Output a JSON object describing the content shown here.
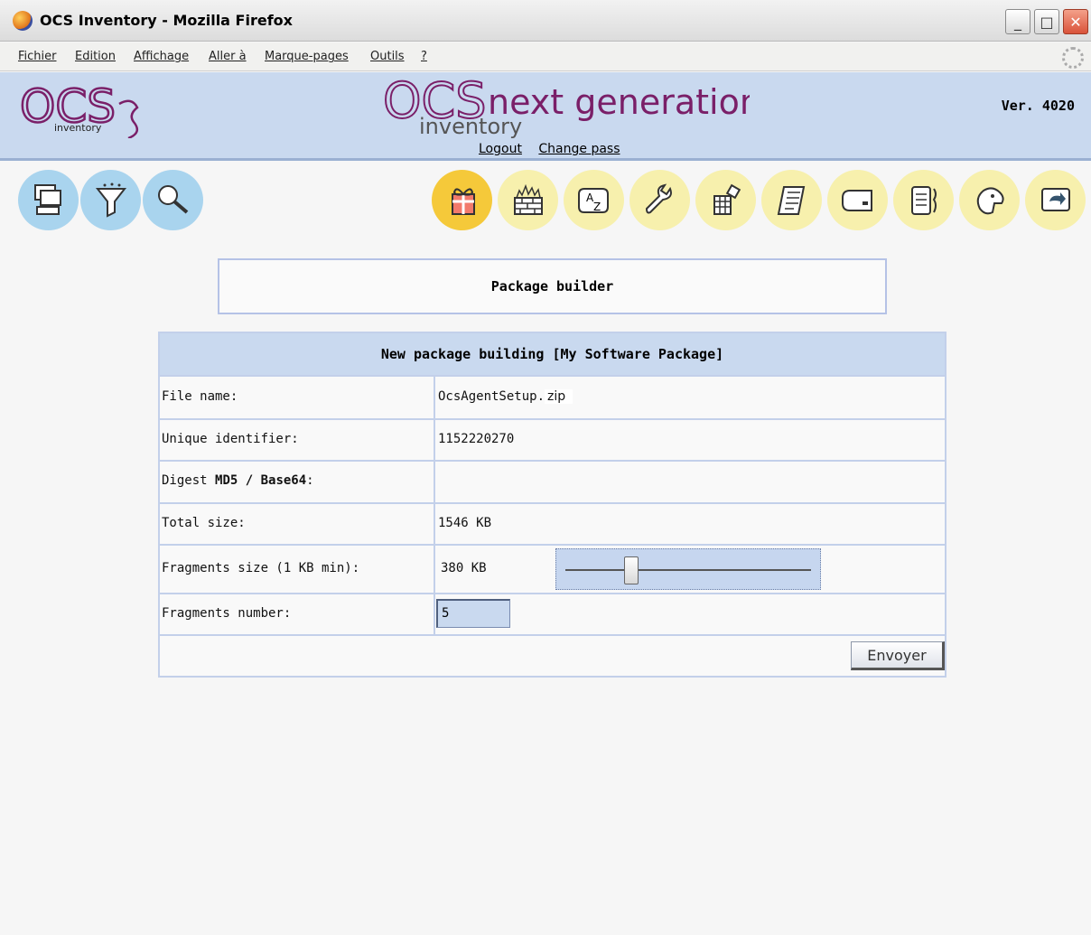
{
  "window": {
    "title": "OCS Inventory - Mozilla Firefox",
    "minimize": "_",
    "maximize": "□",
    "close": "✕"
  },
  "menu": [
    "Fichier",
    "Edition",
    "Affichage",
    "Aller à",
    "Marque-pages",
    "Outils",
    "?"
  ],
  "banner": {
    "logo_left_text": "OCS",
    "logo_left_sub": "inventory",
    "logo_center_main": "OCS",
    "logo_center_next": "next generation",
    "logo_center_sub": "inventory",
    "version": "Ver. 4020",
    "logout": "Logout",
    "change_pass": "Change pass"
  },
  "nav_icons": {
    "left": [
      "computers-icon",
      "filter-icon",
      "search-icon"
    ],
    "right": [
      "package-icon",
      "firewall-icon",
      "dictionary-icon",
      "config-icon",
      "registry-icon",
      "script-icon",
      "device-icon",
      "ipdiscover-icon",
      "user-icon",
      "back-icon"
    ]
  },
  "page_title": "Package builder",
  "form": {
    "heading": "New package building [My Software Package]",
    "rows": {
      "file_name_label": "File name:",
      "file_name_value": "OcsAgentSetup.",
      "file_name_ext": "zip",
      "unique_id_label": "Unique identifier:",
      "unique_id_value": "1152220270",
      "digest_label_pre": "Digest ",
      "digest_label_bold": "MD5 / Base64",
      "digest_label_post": ":",
      "total_size_label": "Total size:",
      "total_size_value": "1546 KB",
      "fragments_size_label": "Fragments size (1 KB min):",
      "fragments_size_value": "380 KB",
      "fragments_number_label": "Fragments number:",
      "fragments_number_value": "5",
      "submit_label": "Envoyer"
    },
    "slider_fraction": 0.25
  }
}
